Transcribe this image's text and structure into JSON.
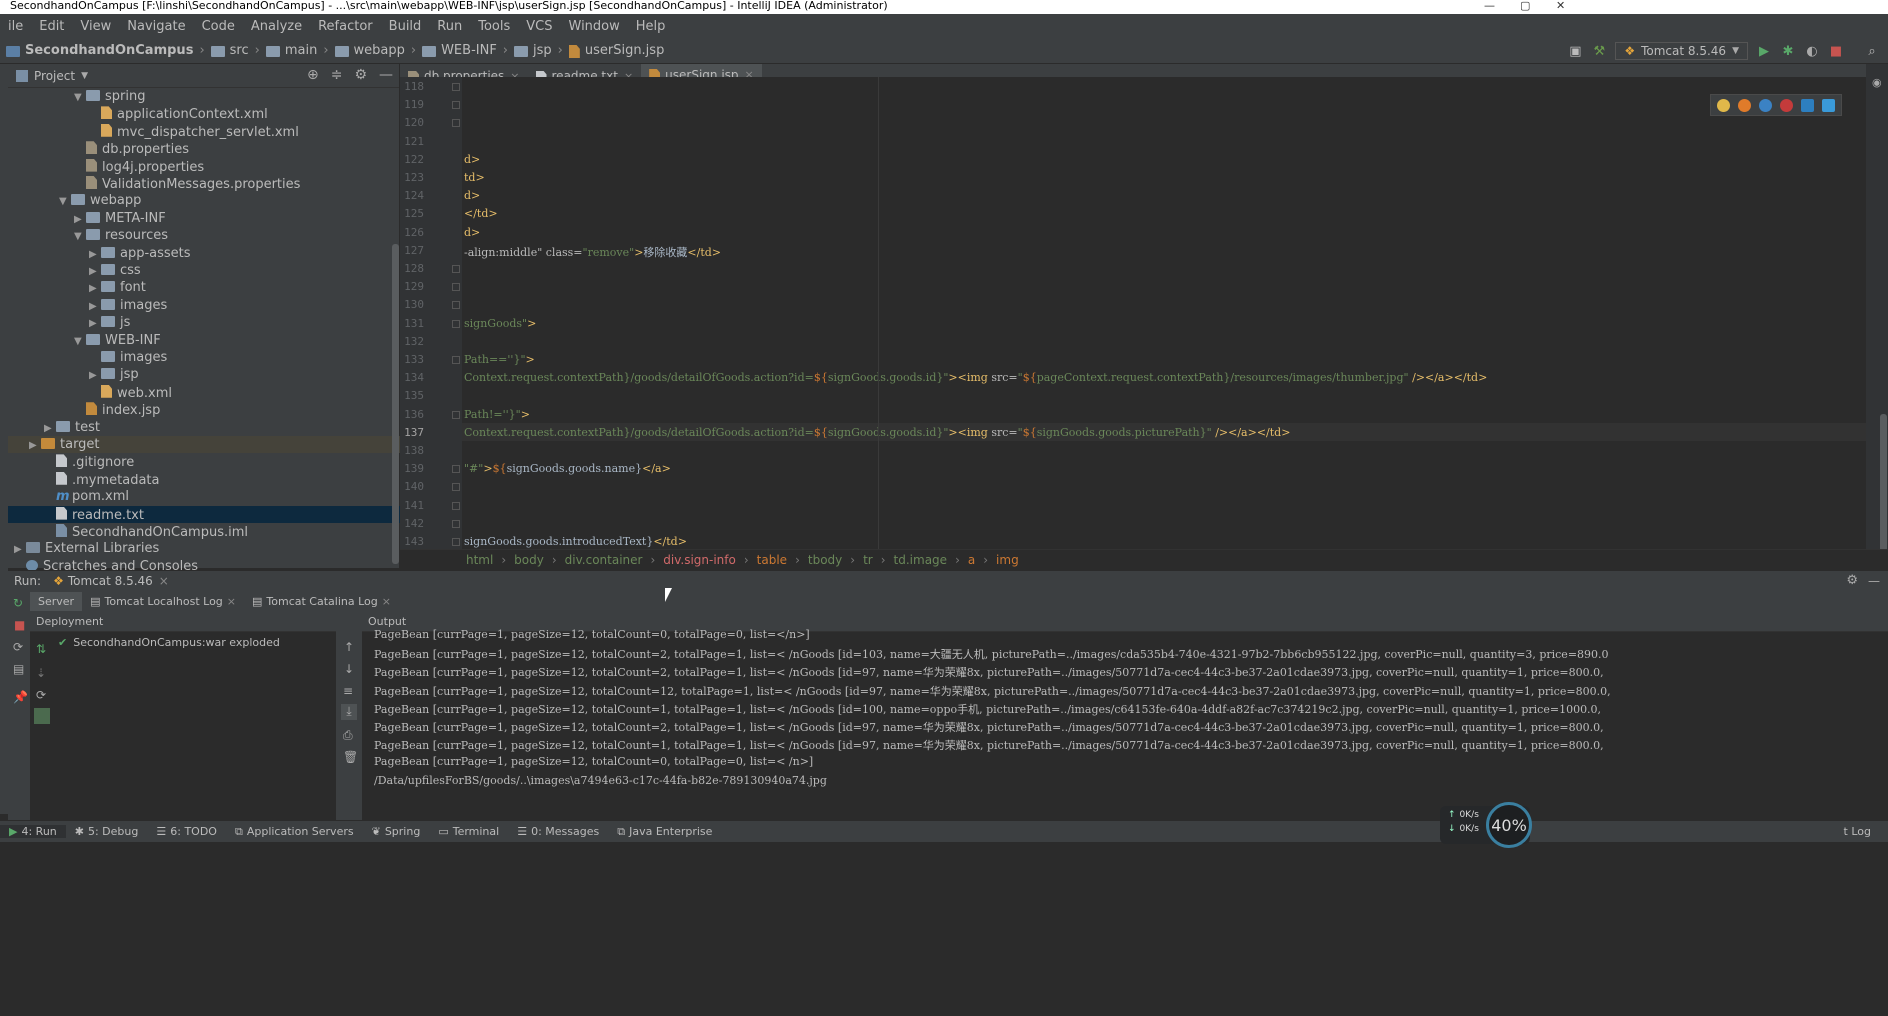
{
  "window": {
    "title": "SecondhandOnCampus [F:\\linshi\\SecondhandOnCampus] - ...\\src\\main\\webapp\\WEB-INF\\jsp\\userSign.jsp [SecondhandOnCampus] - IntelliJ IDEA (Administrator)"
  },
  "menu": [
    "ile",
    "Edit",
    "View",
    "Navigate",
    "Code",
    "Analyze",
    "Refactor",
    "Build",
    "Run",
    "Tools",
    "VCS",
    "Window",
    "Help"
  ],
  "navbar": {
    "crumbs": [
      "SecondhandOnCampus",
      "src",
      "main",
      "webapp",
      "WEB-INF",
      "jsp",
      "userSign.jsp"
    ],
    "run_config": "Tomcat 8.5.46"
  },
  "project": {
    "header": "Project",
    "tree": [
      {
        "label": "spring",
        "kind": "folder",
        "depth": 4,
        "open": true
      },
      {
        "label": "applicationContext.xml",
        "kind": "xml",
        "depth": 5
      },
      {
        "label": "mvc_dispatcher_servlet.xml",
        "kind": "xml",
        "depth": 5
      },
      {
        "label": "db.properties",
        "kind": "prop",
        "depth": 4
      },
      {
        "label": "log4j.properties",
        "kind": "prop",
        "depth": 4
      },
      {
        "label": "ValidationMessages.properties",
        "kind": "prop",
        "depth": 4
      },
      {
        "label": "webapp",
        "kind": "folder",
        "depth": 3,
        "open": true
      },
      {
        "label": "META-INF",
        "kind": "folder",
        "depth": 4,
        "open": false
      },
      {
        "label": "resources",
        "kind": "folder",
        "depth": 4,
        "open": true
      },
      {
        "label": "app-assets",
        "kind": "folder",
        "depth": 5,
        "open": false
      },
      {
        "label": "css",
        "kind": "folder",
        "depth": 5,
        "open": false
      },
      {
        "label": "font",
        "kind": "folder",
        "depth": 5,
        "open": false
      },
      {
        "label": "images",
        "kind": "folder",
        "depth": 5,
        "open": false
      },
      {
        "label": "js",
        "kind": "folder",
        "depth": 5,
        "open": false
      },
      {
        "label": "WEB-INF",
        "kind": "folder",
        "depth": 4,
        "open": true
      },
      {
        "label": "images",
        "kind": "folder",
        "depth": 5
      },
      {
        "label": "jsp",
        "kind": "folder",
        "depth": 5,
        "open": false
      },
      {
        "label": "web.xml",
        "kind": "xml",
        "depth": 5
      },
      {
        "label": "index.jsp",
        "kind": "jsp",
        "depth": 4
      },
      {
        "label": "test",
        "kind": "folder",
        "depth": 2,
        "open": false
      },
      {
        "label": "target",
        "kind": "folder-orange",
        "depth": 1,
        "open": false
      },
      {
        "label": ".gitignore",
        "kind": "txt",
        "depth": 2
      },
      {
        "label": ".mymetadata",
        "kind": "txt",
        "depth": 2
      },
      {
        "label": "pom.xml",
        "kind": "maven",
        "depth": 2
      },
      {
        "label": "readme.txt",
        "kind": "txt",
        "depth": 2
      },
      {
        "label": "SecondhandOnCampus.iml",
        "kind": "iml",
        "depth": 2
      },
      {
        "label": "External Libraries",
        "kind": "lib",
        "depth": 0,
        "open": false
      },
      {
        "label": "Scratches and Consoles",
        "kind": "scratch",
        "depth": 0
      }
    ],
    "selected": "readme.txt"
  },
  "tabs": [
    {
      "label": "db.properties",
      "active": false
    },
    {
      "label": "readme.txt",
      "active": false
    },
    {
      "label": "userSign.jsp",
      "active": true
    }
  ],
  "code_lines": [
    {
      "n": "118",
      "html": ""
    },
    {
      "n": "119",
      "html": ""
    },
    {
      "n": "120",
      "html": ""
    },
    {
      "n": "121",
      "html": ""
    },
    {
      "n": "122",
      "html": "<span class='t'>d&gt;</span>"
    },
    {
      "n": "123",
      "html": "<span class='t'>td&gt;</span>"
    },
    {
      "n": "124",
      "html": "<span class='t'>d&gt;</span>"
    },
    {
      "n": "125",
      "html": "<span class='t'>&lt;/td&gt;</span>"
    },
    {
      "n": "126",
      "html": "<span class='t'>d&gt;</span>"
    },
    {
      "n": "127",
      "html": "<span class='a'>-align:middle\"</span> <span class='a'>class=</span><span class='s'>\"remove\"</span><span class='t'>&gt;</span>移除收藏<span class='t'>&lt;/td&gt;</span>"
    },
    {
      "n": "128",
      "html": ""
    },
    {
      "n": "129",
      "html": ""
    },
    {
      "n": "130",
      "html": ""
    },
    {
      "n": "131",
      "html": "<span class='s'>signGoods\"</span><span class='t'>&gt;</span>"
    },
    {
      "n": "132",
      "html": ""
    },
    {
      "n": "133",
      "html": "<span class='s'>Path==''}\"</span><span class='t'>&gt;</span>"
    },
    {
      "n": "134",
      "html": "<span class='s'>Context.request.contextPath}/goods/detailOfGoods.action?id=</span><span class='v'>${</span><span class='s'>signGoods.goods.id}\"</span><span class='t'>&gt;&lt;img</span> <span class='a'>src=</span><span class='s'>\"</span><span class='v'>${</span><span class='s'>pageContext.request.contextPath}/resources/images/thumber.jpg\"</span>  <span class='t'>/&gt;&lt;/a&gt;&lt;/td&gt;</span>"
    },
    {
      "n": "135",
      "html": ""
    },
    {
      "n": "136",
      "html": "<span class='s'>Path!=''}\"</span><span class='t'>&gt;</span>"
    },
    {
      "n": "137",
      "html": "<span class='s'>Context.request.contextPath}/goods/detailOfGoods.action?id=</span><span class='v'>${</span><span class='s'>signGoods.goods.id}\"</span><span class='t'>&gt;&lt;img</span> <span class='a'>src=</span><span class='s'>\"</span><span class='v'>${</span><span class='s'>signGoods.goods.picturePath}\"</span>  <span class='t'>/&gt;&lt;/a&gt;&lt;/td&gt;</span>"
    },
    {
      "n": "138",
      "html": ""
    },
    {
      "n": "139",
      "html": "<span class='s'>\"#\"</span><span class='t'>&gt;</span><span class='v'>${</span>signGoods.goods.name}<span class='t'>&lt;/a&gt;</span>"
    },
    {
      "n": "140",
      "html": ""
    },
    {
      "n": "141",
      "html": ""
    },
    {
      "n": "142",
      "html": ""
    },
    {
      "n": "143",
      "html": "signGoods.goods.introducedText}<span class='t'>&lt;/td&gt;</span>"
    }
  ],
  "current_line": "137",
  "editor_breadcrumbs": [
    "html",
    "body",
    "div.container",
    "div.sign-info",
    "table",
    "tbody",
    "tr",
    "td.image",
    "a",
    "img"
  ],
  "run": {
    "label": "Run:",
    "config_tab": "Tomcat 8.5.46",
    "tabs": [
      "Server",
      "Tomcat Localhost Log",
      "Tomcat Catalina Log"
    ],
    "deployment_header": "Deployment",
    "output_header": "Output",
    "deployment_item": "SecondhandOnCampus:war exploded",
    "output_lines": [
      "PageBean [currPage=1, pageSize=12, totalCount=0, totalPage=0, list=</n>]",
      "PageBean [currPage=1, pageSize=12, totalCount=2, totalPage=1, list=< /nGoods [id=103, name=大疆无人机, picturePath=../images/cda535b4-740e-4321-97b2-7bb6cb955122.jpg, coverPic=null, quantity=3, price=890.0",
      "PageBean [currPage=1, pageSize=12, totalCount=2, totalPage=1, list=< /nGoods [id=97, name=华为荣耀8x, picturePath=../images/50771d7a-cec4-44c3-be37-2a01cdae3973.jpg, coverPic=null, quantity=1, price=800.0,",
      "PageBean [currPage=1, pageSize=12, totalCount=12, totalPage=1, list=< /nGoods [id=97, name=华为荣耀8x, picturePath=../images/50771d7a-cec4-44c3-be37-2a01cdae3973.jpg, coverPic=null, quantity=1, price=800.0,",
      "PageBean [currPage=1, pageSize=12, totalCount=1, totalPage=1, list=< /nGoods [id=100, name=oppo手机, picturePath=../images/c64153fe-640a-4ddf-a82f-ac7c374219c2.jpg, coverPic=null, quantity=1, price=1000.0,",
      "PageBean [currPage=1, pageSize=12, totalCount=2, totalPage=1, list=< /nGoods [id=97, name=华为荣耀8x, picturePath=../images/50771d7a-cec4-44c3-be37-2a01cdae3973.jpg, coverPic=null, quantity=1, price=800.0,",
      "PageBean [currPage=1, pageSize=12, totalCount=1, totalPage=1, list=< /nGoods [id=97, name=华为荣耀8x, picturePath=../images/50771d7a-cec4-44c3-be37-2a01cdae3973.jpg, coverPic=null, quantity=1, price=800.0,",
      "PageBean [currPage=1, pageSize=12, totalCount=0, totalPage=0, list=< /n>]",
      "/Data/upfilesForBS/goods/..\\images\\a7494e63-c17c-44fa-b82e-789130940a74.jpg"
    ]
  },
  "bottom_tools": [
    "4: Run",
    "5: Debug",
    "6: TODO",
    "Application Servers",
    "Spring",
    "Terminal",
    "0: Messages",
    "Java Enterprise"
  ],
  "bottom_right": "t Log",
  "net": {
    "up": "0K/s",
    "down": "0K/s",
    "percent": "40%"
  }
}
